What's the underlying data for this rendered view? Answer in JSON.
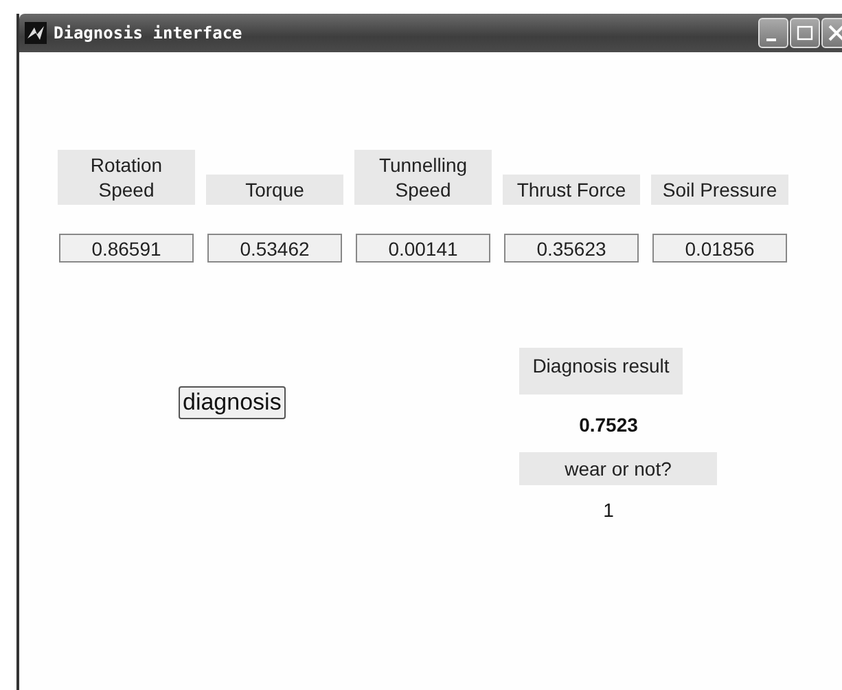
{
  "window": {
    "title": "Diagnosis interface"
  },
  "parameters": [
    {
      "label": "Rotation Speed",
      "value": "0.86591"
    },
    {
      "label": "Torque",
      "value": "0.53462"
    },
    {
      "label": "Tunnelling Speed",
      "value": "0.00141"
    },
    {
      "label": "Thrust Force",
      "value": "0.35623"
    },
    {
      "label": "Soil Pressure",
      "value": "0.01856"
    }
  ],
  "diagnose_button": {
    "label": "diagnosis"
  },
  "results": {
    "result_label": "Diagnosis result",
    "result_value": "0.7523",
    "wear_label": "wear or not?",
    "wear_value": "1"
  }
}
